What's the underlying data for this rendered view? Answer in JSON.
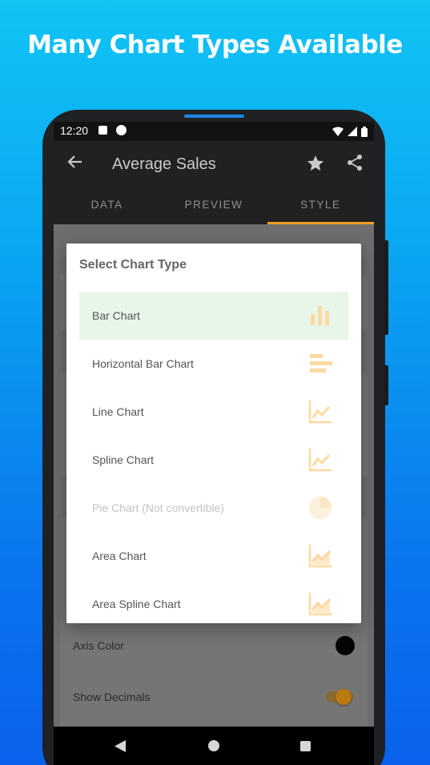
{
  "headline": "Many Chart Types Available",
  "status_bar": {
    "time": "12:20"
  },
  "app_bar": {
    "title": "Average Sales"
  },
  "tabs": [
    {
      "label": "DATA"
    },
    {
      "label": "PREVIEW"
    },
    {
      "label": "STYLE",
      "active": true
    }
  ],
  "background_settings": {
    "axis_color_label": "Axis Color",
    "show_decimals_label": "Show Decimals"
  },
  "dialog": {
    "title": "Select Chart Type",
    "options": [
      {
        "label": "Bar Chart",
        "icon": "bar-chart-icon",
        "selected": true
      },
      {
        "label": "Horizontal Bar Chart",
        "icon": "horizontal-bar-chart-icon"
      },
      {
        "label": "Line Chart",
        "icon": "line-chart-icon"
      },
      {
        "label": "Spline Chart",
        "icon": "spline-chart-icon"
      },
      {
        "label": "Pie Chart (Not convertible)",
        "icon": "pie-chart-icon",
        "disabled": true
      },
      {
        "label": "Area Chart",
        "icon": "area-chart-icon"
      },
      {
        "label": "Area Spline Chart",
        "icon": "area-spline-chart-icon"
      }
    ]
  },
  "colors": {
    "accent": "#f0a020",
    "icon": "#fbd9a0",
    "selected_bg": "#e8f5e9",
    "background_top": "#10c4f4",
    "background_bottom": "#0a62ec"
  }
}
